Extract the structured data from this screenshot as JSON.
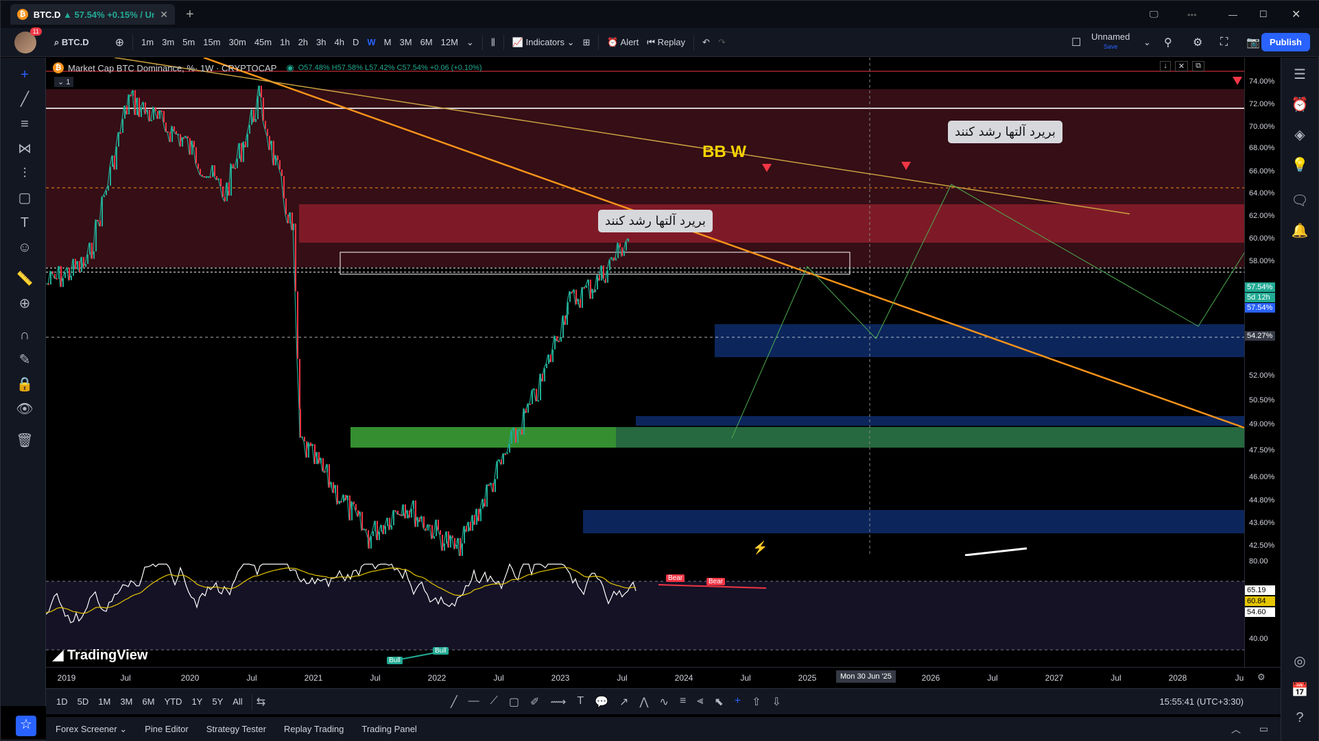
{
  "browser": {
    "tab_symbol": "BTC.D",
    "tab_change": "▲ 57.54% +0.15% / Un",
    "new_tab": "+"
  },
  "toolbar": {
    "symbol": "BTC.D",
    "badge": "11",
    "timeframes": [
      "1m",
      "3m",
      "5m",
      "15m",
      "30m",
      "45m",
      "1h",
      "2h",
      "3h",
      "4h",
      "D",
      "W",
      "M",
      "3M",
      "6M",
      "12M"
    ],
    "active_timeframe": "W",
    "indicators": "Indicators",
    "alert": "Alert",
    "replay": "Replay",
    "layout_name": "Unnamed",
    "layout_status": "Save",
    "publish": "Publish"
  },
  "chart": {
    "title": "Market Cap BTC Dominance, %· 1W · CRYPTOCAP",
    "ohlc": "O57.48% H57.58% L57.42% C57.54% +0.06 (+0.10%)",
    "pane_count": "1",
    "callout_top": "بریرد آلتها رشد کنند",
    "callout_mid": "بریرد آلتها رشد کنند",
    "bbw": "BB W",
    "watermark": "TradingView",
    "rsi_bull_1": "Bull",
    "rsi_bull_2": "Bull",
    "rsi_bear_1": "Bear",
    "rsi_bear_2": "Bear"
  },
  "price_axis": {
    "labels": [
      "74.00%",
      "72.00%",
      "70.00%",
      "68.00%",
      "66.00%",
      "64.00%",
      "62.00%",
      "60.00%",
      "58.00%",
      "52.00%",
      "50.50%",
      "49.00%",
      "47.50%",
      "46.00%",
      "44.80%",
      "43.60%",
      "42.50%"
    ],
    "last_price": "57.54%",
    "countdown": "5d 12h",
    "last_price_2": "57.54%",
    "crosshair_price": "54.27%",
    "rsi_labels": [
      "80.00",
      "40.00"
    ],
    "rsi_values": [
      "65.19",
      "60.84",
      "54.60"
    ]
  },
  "time_axis": {
    "labels": [
      "2019",
      "Jul",
      "2020",
      "Jul",
      "2021",
      "Jul",
      "2022",
      "Jul",
      "2023",
      "Jul",
      "2024",
      "Jul",
      "2025",
      "2026",
      "Jul",
      "2027",
      "Jul",
      "2028",
      "Ju"
    ],
    "crosshair_date": "Mon 30 Jun '25"
  },
  "bottom": {
    "ranges": [
      "1D",
      "5D",
      "1M",
      "3M",
      "6M",
      "YTD",
      "1Y",
      "5Y",
      "All"
    ],
    "clock": "15:55:41 (UTC+3:30)"
  },
  "panels": [
    "Forex Screener",
    "Pine Editor",
    "Strategy Tester",
    "Replay Trading",
    "Trading Panel"
  ],
  "colors": {
    "accent": "#2962ff",
    "up": "#22ab94",
    "down": "#f23645",
    "trend_orange": "#f7931a",
    "rsi": "#ffffff",
    "rsi_ma": "#e5c500"
  }
}
